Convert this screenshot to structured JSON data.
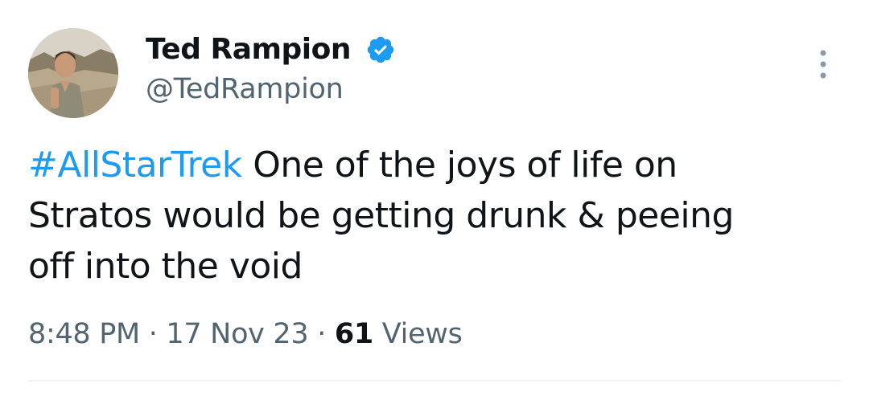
{
  "author": {
    "display_name": "Ted Rampion",
    "handle": "@TedRampion",
    "verified": true,
    "avatar_icon": "profile-photo-icon",
    "verified_icon": "verified-badge-icon"
  },
  "tweet": {
    "hashtag": "#AllStarTrek",
    "text_line1": "One of the joys of life on",
    "text_line2": "Stratos would be getting drunk & peeing",
    "text_line3": "off into the void"
  },
  "meta": {
    "time": "8:48 PM",
    "separator": "·",
    "date": "17 Nov 23",
    "views_count": "61",
    "views_label": "Views"
  },
  "menu_icon": "more-options-icon",
  "colors": {
    "text": "#0f1419",
    "secondary": "#536471",
    "accent": "#1d9bf0",
    "divider": "#eff3f4"
  }
}
